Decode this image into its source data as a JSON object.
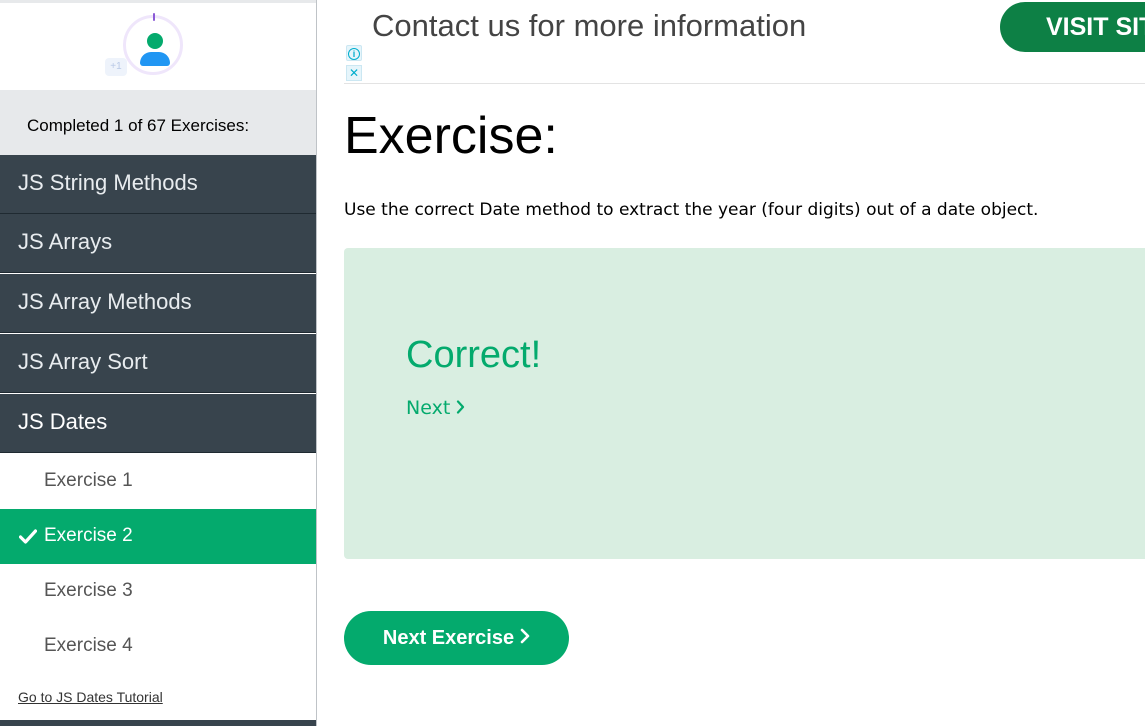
{
  "sidebar": {
    "progress_text": "Completed 1 of 67 Exercises:",
    "avatar_badge": "+1",
    "nav": [
      {
        "label": "JS String Methods"
      },
      {
        "label": "JS Arrays"
      },
      {
        "label": "JS Array Methods"
      },
      {
        "label": "JS Array Sort"
      },
      {
        "label": "JS Dates"
      }
    ],
    "exercises": [
      {
        "label": "Exercise 1",
        "completed": false,
        "current": false
      },
      {
        "label": "Exercise 2",
        "completed": true,
        "current": true
      },
      {
        "label": "Exercise 3",
        "completed": false,
        "current": false
      },
      {
        "label": "Exercise 4",
        "completed": false,
        "current": false
      }
    ],
    "tutorial_link": "Go to JS Dates Tutorial"
  },
  "ad": {
    "text": "Contact us for more information",
    "button_label": "VISIT SITE",
    "info_icon": "info-icon",
    "close_icon": "close-icon"
  },
  "main": {
    "heading": "Exercise:",
    "instruction": "Use the correct Date method to extract the year (four digits) out of a date object.",
    "result": {
      "title": "Correct!",
      "next_label": "Next"
    },
    "next_exercise_label": "Next Exercise"
  },
  "colors": {
    "accent_green": "#04aa6d",
    "sidebar_dark": "#38444d",
    "result_bg": "#d9eee1",
    "ad_button": "#0d8045"
  }
}
